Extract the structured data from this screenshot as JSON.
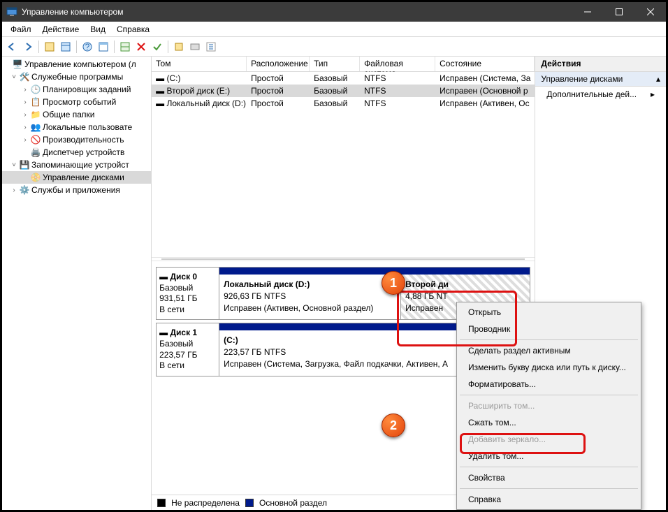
{
  "window": {
    "title": "Управление компьютером"
  },
  "menubar": [
    "Файл",
    "Действие",
    "Вид",
    "Справка"
  ],
  "tree": {
    "root": "Управление компьютером (л",
    "g1": "Служебные программы",
    "i1": "Планировщик заданий",
    "i2": "Просмотр событий",
    "i3": "Общие папки",
    "i4": "Локальные пользовате",
    "i5": "Производительность",
    "i6": "Диспетчер устройств",
    "g2": "Запоминающие устройст",
    "i7": "Управление дисками",
    "g3": "Службы и приложения"
  },
  "cols": {
    "v": "Том",
    "l": "Расположение",
    "t": "Тип",
    "f": "Файловая система",
    "s": "Состояние"
  },
  "rows": [
    {
      "v": "(C:)",
      "l": "Простой",
      "t": "Базовый",
      "f": "NTFS",
      "s": "Исправен (Система, За"
    },
    {
      "v": "Второй диск (E:)",
      "l": "Простой",
      "t": "Базовый",
      "f": "NTFS",
      "s": "Исправен (Основной р"
    },
    {
      "v": "Локальный диск (D:)",
      "l": "Простой",
      "t": "Базовый",
      "f": "NTFS",
      "s": "Исправен (Активен, Ос"
    }
  ],
  "disk0": {
    "name": "Диск 0",
    "type": "Базовый",
    "size": "931,51 ГБ",
    "state": "В сети",
    "volD": {
      "title": "Локальный диск  (D:)",
      "size": "926,63 ГБ NTFS",
      "status": "Исправен (Активен, Основной раздел)"
    },
    "volE": {
      "title": "Второй ди",
      "size": "4,88 ГБ NT",
      "status": "Исправен"
    }
  },
  "disk1": {
    "name": "Диск 1",
    "type": "Базовый",
    "size": "223,57 ГБ",
    "state": "В сети",
    "volC": {
      "title": "(C:)",
      "size": "223,57 ГБ NTFS",
      "status": "Исправен (Система, Загрузка, Файл подкачки, Активен, А"
    }
  },
  "legend": {
    "unalloc": "Не распределена",
    "primary": "Основной раздел"
  },
  "actions": {
    "header": "Действия",
    "disk": "Управление дисками",
    "more": "Дополнительные дей..."
  },
  "ctx": {
    "open": "Открыть",
    "explorer": "Проводник",
    "active": "Сделать раздел активным",
    "letter": "Изменить букву диска или путь к диску...",
    "format": "Форматировать...",
    "extend": "Расширить том...",
    "shrink": "Сжать том...",
    "mirror": "Добавить зеркало...",
    "delete": "Удалить том...",
    "props": "Свойства",
    "help": "Справка"
  },
  "callouts": {
    "c1": "1",
    "c2": "2"
  }
}
